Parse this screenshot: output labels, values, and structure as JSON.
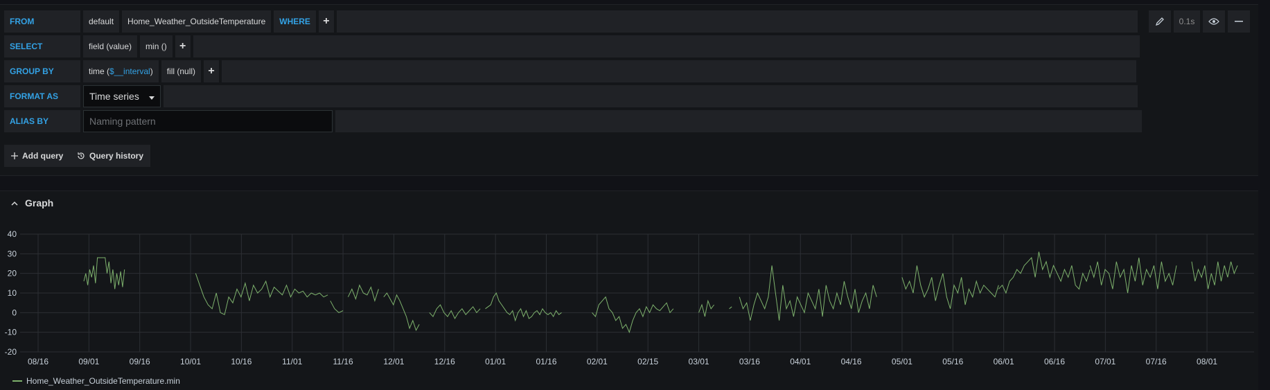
{
  "query": {
    "from": {
      "keyword": "FROM",
      "policy": "default",
      "measurement": "Home_Weather_OutsideTemperature",
      "where_keyword": "WHERE"
    },
    "select": {
      "keyword": "SELECT",
      "field": "field (value)",
      "fn": "min ()"
    },
    "group_by": {
      "keyword": "GROUP BY",
      "time_prefix": "time (",
      "time_interval": "$__interval",
      "time_suffix": ")",
      "fill": "fill (null)"
    },
    "format_as": {
      "keyword": "FORMAT AS",
      "selected": "Time series"
    },
    "alias_by": {
      "keyword": "ALIAS BY",
      "placeholder": "Naming pattern",
      "value": ""
    },
    "plus_label": "+"
  },
  "toolbar": {
    "query_time": "0.1s"
  },
  "buttons": {
    "add_query": "Add query",
    "query_history": "Query history"
  },
  "graph": {
    "title": "Graph"
  },
  "chart_data": {
    "type": "line",
    "ylim": [
      -20,
      40
    ],
    "yticks": [
      40,
      30,
      20,
      10,
      0,
      -10,
      -20
    ],
    "xticks": [
      "08/16",
      "09/01",
      "09/16",
      "10/01",
      "10/16",
      "11/01",
      "11/16",
      "12/01",
      "12/16",
      "01/01",
      "01/16",
      "02/01",
      "02/15",
      "03/01",
      "03/16",
      "04/01",
      "04/16",
      "05/01",
      "05/16",
      "06/01",
      "06/16",
      "07/01",
      "07/16",
      "08/01"
    ],
    "grid": true,
    "legend_position": "bottom-left",
    "color": "#7eb26d",
    "series": [
      {
        "name": "Home_Weather_OutsideTemperature.min",
        "segments": [
          {
            "from_tick": 0.9,
            "to_tick": 1.7,
            "values": [
              16,
              20,
              14,
              22,
              18,
              24,
              15,
              28,
              28,
              28,
              28,
              28,
              20,
              26,
              15,
              22,
              12,
              20,
              14,
              21,
              13,
              22
            ]
          },
          {
            "from_tick": 3.1,
            "to_tick": 5.7,
            "values": [
              20,
              14,
              8,
              4,
              2,
              10,
              0,
              -1,
              8,
              5,
              12,
              8,
              15,
              6,
              14,
              10,
              12,
              16,
              8,
              13,
              11,
              9,
              14,
              8,
              12,
              10,
              11,
              8,
              10,
              9,
              10,
              8,
              9
            ]
          },
          {
            "from_tick": 5.75,
            "to_tick": 6.0,
            "values": [
              6,
              2,
              0,
              1
            ]
          },
          {
            "from_tick": 6.1,
            "to_tick": 6.7,
            "values": [
              8,
              12,
              7,
              14,
              10,
              9,
              13,
              6,
              12
            ]
          },
          {
            "from_tick": 6.8,
            "to_tick": 7.5,
            "values": [
              8,
              10,
              7,
              4,
              9,
              6,
              2,
              -2,
              -8,
              -4,
              -9,
              -6
            ]
          },
          {
            "from_tick": 7.7,
            "to_tick": 8.7,
            "values": [
              0,
              -2,
              2,
              4,
              0,
              -2,
              1,
              -3,
              0,
              2,
              -1,
              1,
              3,
              0,
              2
            ]
          },
          {
            "from_tick": 8.8,
            "to_tick": 10.3,
            "values": [
              2,
              3,
              4,
              8,
              10,
              6,
              4,
              2,
              0,
              -1,
              1,
              -4,
              0,
              2,
              -2,
              1,
              -3,
              -2,
              0,
              1,
              -1,
              2,
              0,
              -1,
              0,
              -2,
              1,
              -1,
              0
            ]
          },
          {
            "from_tick": 10.9,
            "to_tick": 12.5,
            "values": [
              0,
              -2,
              4,
              6,
              8,
              2,
              0,
              -4,
              -2,
              -8,
              -6,
              -10,
              -4,
              0,
              2,
              -2,
              3,
              0,
              4,
              2,
              1,
              3,
              5,
              0,
              2
            ]
          },
          {
            "from_tick": 13.0,
            "to_tick": 13.3,
            "values": [
              0,
              4,
              -2,
              6,
              2,
              4
            ]
          },
          {
            "from_tick": 13.6,
            "to_tick": 13.65,
            "values": [
              2,
              3
            ]
          },
          {
            "from_tick": 13.8,
            "to_tick": 16.5,
            "values": [
              8,
              2,
              5,
              -4,
              4,
              10,
              6,
              2,
              8,
              24,
              10,
              -4,
              14,
              2,
              6,
              -2,
              8,
              4,
              0,
              10,
              6,
              2,
              12,
              -2,
              14,
              6,
              2,
              10,
              4,
              16,
              8,
              2,
              12,
              0,
              6,
              10,
              2,
              14,
              8
            ]
          },
          {
            "from_tick": 17.0,
            "to_tick": 18.9,
            "values": [
              18,
              12,
              16,
              10,
              24,
              14,
              8,
              12,
              18,
              6,
              14,
              20,
              8,
              2,
              14,
              10,
              18,
              4,
              12,
              8,
              16,
              10,
              14,
              12,
              10,
              8,
              14
            ]
          },
          {
            "from_tick": 18.9,
            "to_tick": 20.7,
            "values": [
              12,
              14,
              10,
              16,
              18,
              22,
              20,
              24,
              26,
              28,
              18,
              31,
              22,
              26,
              18,
              24,
              20,
              16,
              22,
              18,
              24,
              14,
              12,
              20,
              16,
              22
            ]
          },
          {
            "from_tick": 20.7,
            "to_tick": 22.4,
            "values": [
              24,
              18,
              26,
              14,
              22,
              20,
              12,
              26,
              18,
              22,
              10,
              24,
              16,
              28,
              14,
              22,
              18,
              24,
              12,
              26,
              16,
              20,
              14,
              24
            ]
          },
          {
            "from_tick": 22.7,
            "to_tick": 23.6,
            "values": [
              26,
              16,
              22,
              18,
              24,
              12,
              20,
              14,
              26,
              16,
              24,
              18,
              26,
              20,
              24
            ]
          }
        ]
      }
    ]
  }
}
